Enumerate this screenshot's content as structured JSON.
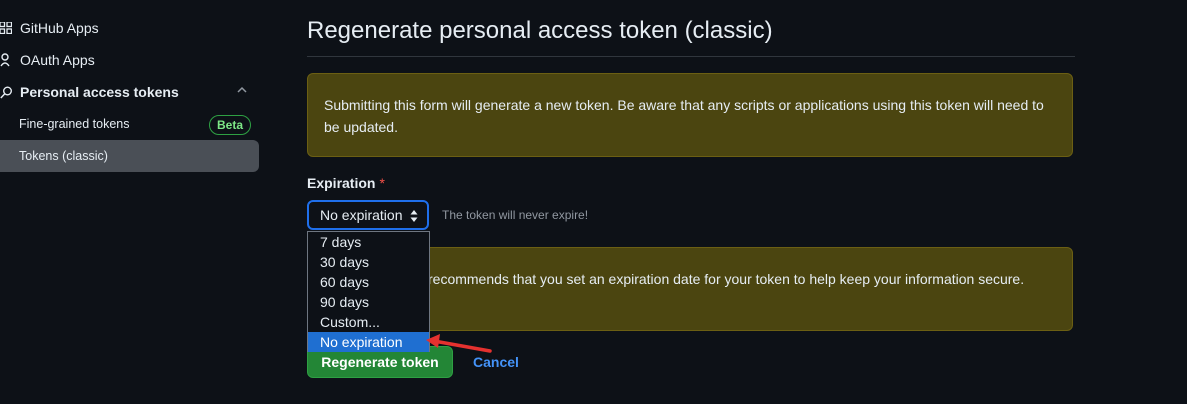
{
  "sidebar": {
    "items": [
      {
        "label": "GitHub Apps",
        "icon": "apps-grid-icon"
      },
      {
        "label": "OAuth Apps",
        "icon": "person-icon"
      },
      {
        "label": "Personal access tokens",
        "icon": "key-icon"
      }
    ],
    "subitems": [
      {
        "label": "Fine-grained tokens",
        "badge": "Beta"
      },
      {
        "label": "Tokens (classic)",
        "active": true
      }
    ]
  },
  "main": {
    "title": "Regenerate personal access token (classic)",
    "warning": "Submitting this form will generate a new token. Be aware that any scripts or applications using this token will need to be updated.",
    "expiration": {
      "label": "Expiration",
      "required_mark": "*",
      "selected": "No expiration",
      "note": "The token will never expire!",
      "options": [
        "7 days",
        "30 days",
        "60 days",
        "90 days",
        "Custom...",
        "No expiration"
      ]
    },
    "recommendation": "recommends that you set an expiration date for your token to help keep your information secure.",
    "buttons": {
      "regenerate": "Regenerate token",
      "cancel": "Cancel"
    }
  },
  "colors": {
    "background": "#0d1117",
    "warning_bg": "#4b4510",
    "primary_button": "#238636",
    "link": "#4493f8",
    "selected_option": "#1f6fd1",
    "annotation_arrow": "#e5312f"
  }
}
